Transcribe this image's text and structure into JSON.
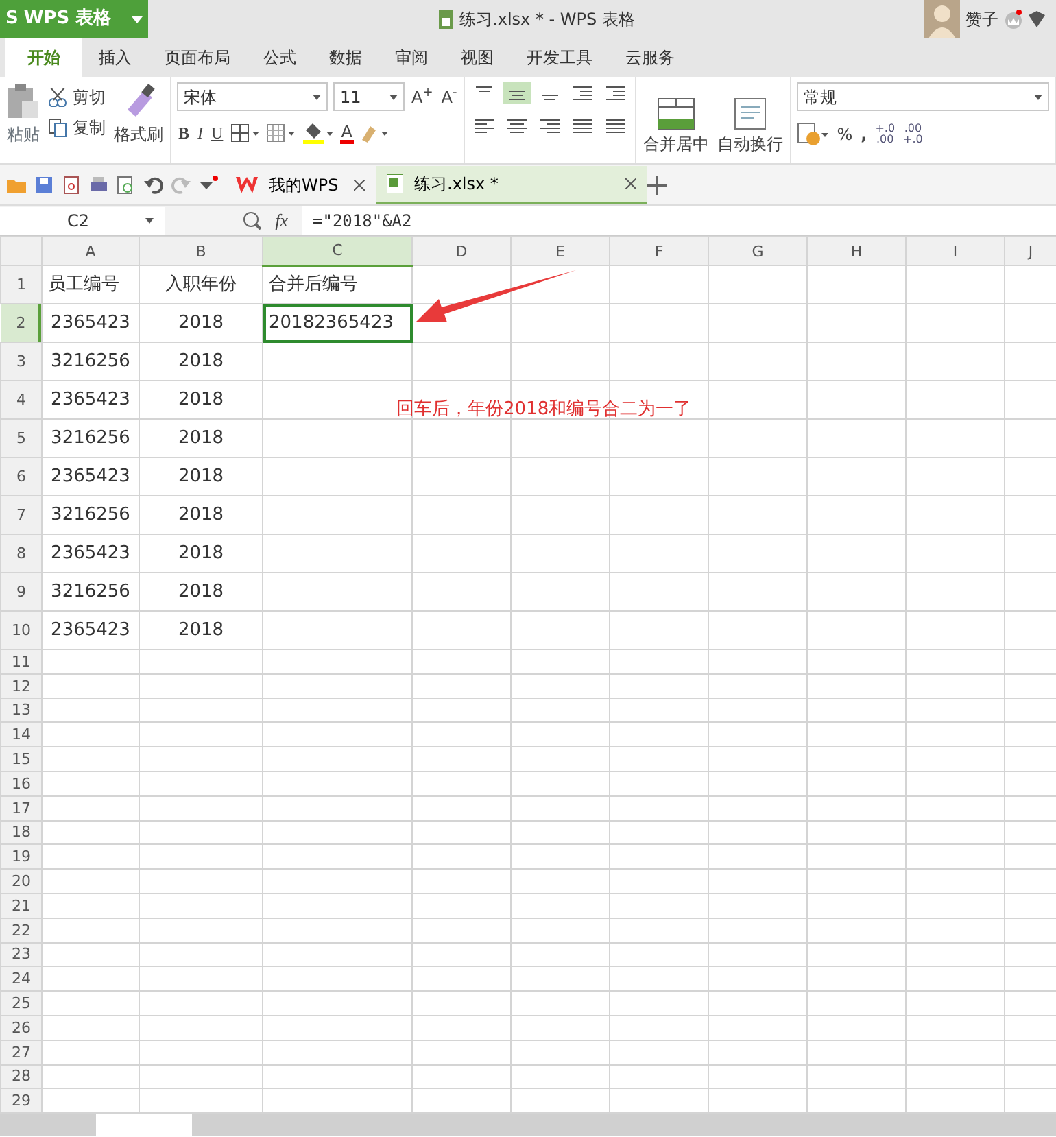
{
  "app": {
    "logo": "S",
    "name": "WPS 表格",
    "title": "练习.xlsx * - WPS 表格",
    "user": "赞子"
  },
  "menu_tabs": [
    {
      "label": "开始",
      "selected": true
    },
    {
      "label": "插入",
      "selected": false
    },
    {
      "label": "页面布局",
      "selected": false
    },
    {
      "label": "公式",
      "selected": false
    },
    {
      "label": "数据",
      "selected": false
    },
    {
      "label": "审阅",
      "selected": false
    },
    {
      "label": "视图",
      "selected": false
    },
    {
      "label": "开发工具",
      "selected": false
    },
    {
      "label": "云服务",
      "selected": false
    }
  ],
  "ribbon": {
    "paste": "粘贴",
    "cut": "剪切",
    "copy": "复制",
    "format_painter": "格式刷",
    "font_name": "宋体",
    "font_size": "11",
    "grow_font": "A$^{+}$",
    "shrink_font": "A$^{-}$",
    "styles": [
      "B",
      "I",
      "U"
    ],
    "font_color": "A",
    "merge": "合并居中",
    "wrap": "自动换行",
    "number_format": "常规",
    "percent": "%",
    "comma": ",",
    "add_decimal": [
      "+.0",
      ".00"
    ],
    "remove_decimal": [
      ".00",
      "+.0"
    ]
  },
  "doc_tabs": [
    {
      "label": "我的WPS",
      "selected": false
    },
    {
      "label": "练习.xlsx *",
      "selected": true
    }
  ],
  "formula_bar": {
    "cell": "C2",
    "fx": "fx",
    "formula": "=\"2018\"&A2"
  },
  "sheet": {
    "columns": [
      {
        "label": "A",
        "selected": false
      },
      {
        "label": "B",
        "selected": false
      },
      {
        "label": "C",
        "selected": true
      },
      {
        "label": "D",
        "selected": false
      },
      {
        "label": "E",
        "selected": false
      },
      {
        "label": "F",
        "selected": false
      },
      {
        "label": "G",
        "selected": false
      },
      {
        "label": "H",
        "selected": false
      },
      {
        "label": "I",
        "selected": false
      },
      {
        "label": "J",
        "selected": false
      }
    ],
    "rows": [
      {
        "number": "1",
        "selected": false,
        "cells": [
          "员工编号",
          "入职年份",
          "合并后编号"
        ]
      },
      {
        "number": "2",
        "selected": true,
        "cells": [
          "2365423",
          "2018",
          "20182365423"
        ]
      },
      {
        "number": "3",
        "selected": false,
        "cells": [
          "3216256",
          "2018"
        ]
      },
      {
        "number": "4",
        "selected": false,
        "cells": [
          "2365423",
          "2018"
        ]
      },
      {
        "number": "5",
        "selected": false,
        "cells": [
          "3216256",
          "2018"
        ]
      },
      {
        "number": "6",
        "selected": false,
        "cells": [
          "2365423",
          "2018"
        ]
      },
      {
        "number": "7",
        "selected": false,
        "cells": [
          "3216256",
          "2018"
        ]
      },
      {
        "number": "8",
        "selected": false,
        "cells": [
          "2365423",
          "2018"
        ]
      },
      {
        "number": "9",
        "selected": false,
        "cells": [
          "3216256",
          "2018"
        ]
      },
      {
        "number": "10",
        "selected": false,
        "cells": [
          "2365423",
          "2018"
        ]
      },
      {
        "number": "11",
        "selected": false
      },
      {
        "number": "12",
        "selected": false
      },
      {
        "number": "13",
        "selected": false
      },
      {
        "number": "14",
        "selected": false
      },
      {
        "number": "15",
        "selected": false
      },
      {
        "number": "16",
        "selected": false
      },
      {
        "number": "17",
        "selected": false
      },
      {
        "number": "18",
        "selected": false
      },
      {
        "number": "19",
        "selected": false
      },
      {
        "number": "20",
        "selected": false
      },
      {
        "number": "21",
        "selected": false
      },
      {
        "number": "22",
        "selected": false
      },
      {
        "number": "23",
        "selected": false
      },
      {
        "number": "24",
        "selected": false
      },
      {
        "number": "25",
        "selected": false
      },
      {
        "number": "26",
        "selected": false
      },
      {
        "number": "27",
        "selected": false
      },
      {
        "number": "28",
        "selected": false
      },
      {
        "number": "29",
        "selected": false
      }
    ]
  },
  "annotation": {
    "text": "回车后，年份2018和编号合二为一了"
  }
}
